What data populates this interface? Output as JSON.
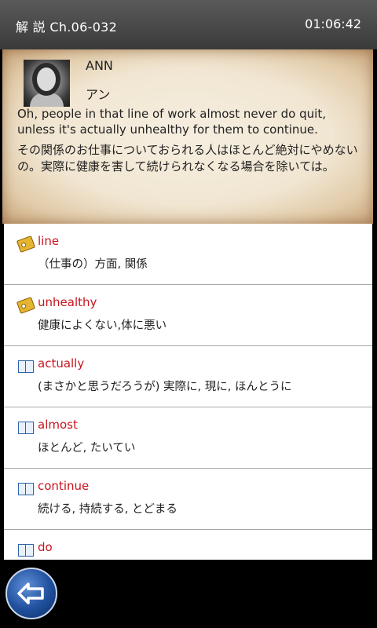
{
  "header": {
    "title": "解 説  Ch.06-032",
    "time": "01:06:42"
  },
  "dialogue": {
    "speaker": "ANN",
    "speaker_jp": "アン",
    "english": "Oh, people in that line of work almost never do quit, unless it's actually unhealthy for them to continue.",
    "japanese": "その関係のお仕事についておられる人はほとんど絶対にやめないの。実際に健康を害して続けられなくなる場合を除いては。"
  },
  "words": [
    {
      "word": "line",
      "definition": "（仕事の）方面, 関係",
      "icon": "tag-icon"
    },
    {
      "word": "unhealthy",
      "definition": "健康によくない,体に悪い",
      "icon": "tag-icon"
    },
    {
      "word": "actually",
      "definition": "(まさかと思うだろうが) 実際に, 現に, ほんとうに",
      "icon": "book-icon"
    },
    {
      "word": "almost",
      "definition": "ほとんど, たいてい",
      "icon": "book-icon"
    },
    {
      "word": "continue",
      "definition": "続ける, 持続する, とどまる",
      "icon": "book-icon"
    },
    {
      "word": "do",
      "definition": "",
      "icon": "book-icon"
    }
  ]
}
